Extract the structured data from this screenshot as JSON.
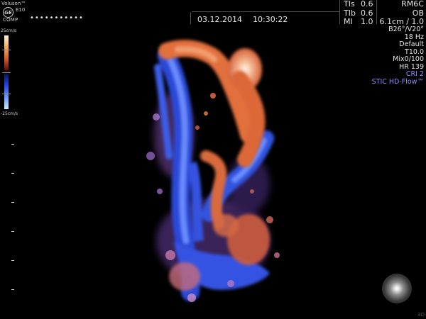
{
  "header": {
    "brand": "Voluson™",
    "model": "E10",
    "logo_text": "GE",
    "comp": "COMP",
    "patient_id": "•••••••••••",
    "date": "03.12.2014",
    "time": "10:30:22"
  },
  "indices": [
    {
      "label": "TIs",
      "value": "0.6"
    },
    {
      "label": "TIb",
      "value": "0.6"
    },
    {
      "label": "MI",
      "value": "1.0"
    }
  ],
  "probe": {
    "probe": "RM6C",
    "preset": "OB",
    "depth_scale": "6.1cm / 1.0"
  },
  "params": {
    "angle": "B26°/V20°",
    "rate": "18 Hz",
    "mode": "Default",
    "t": "T10.0",
    "mix": "Mix0/100",
    "hr": "HR 139",
    "cri": "CRI 2",
    "stic": "STIC HD-Flow™"
  },
  "scale": {
    "top": "25cm/s",
    "bottom": "-25cm/s"
  },
  "corner_label": "3D",
  "colors": {
    "background": "#000000",
    "text": "#e6e6e6",
    "accent_blue": "#8c8cff",
    "flow_red": "#e06a3a",
    "flow_blue": "#3a5ee6"
  }
}
